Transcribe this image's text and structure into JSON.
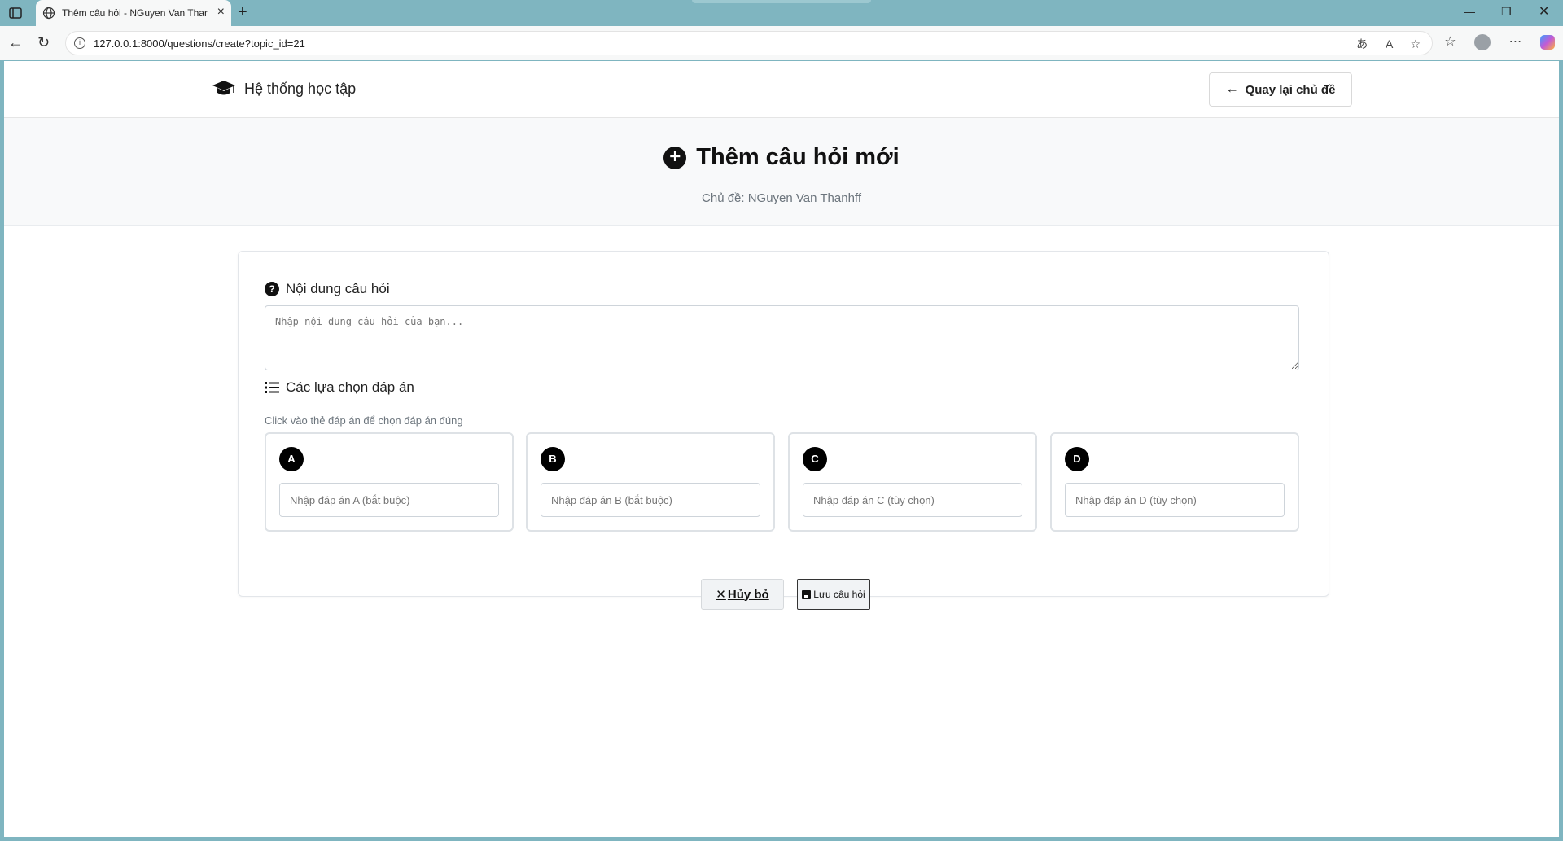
{
  "browser": {
    "tab_title": "Thêm câu hỏi - NGuyen Van Thanhff",
    "url": "127.0.0.1:8000/questions/create?topic_id=21"
  },
  "header": {
    "brand": "Hệ thống học tập",
    "back_label": "Quay lại chủ đề"
  },
  "hero": {
    "title": "Thêm câu hỏi mới",
    "subtitle": "Chủ đề: NGuyen Van Thanhff"
  },
  "form": {
    "question_label": "Nội dung câu hỏi",
    "question_placeholder": "Nhập nội dung câu hỏi của bạn...",
    "options_label": "Các lựa chọn đáp án",
    "options_hint": "Click vào thẻ đáp án để chọn đáp án đúng",
    "options": [
      {
        "letter": "A",
        "placeholder": "Nhập đáp án A (bắt buộc)"
      },
      {
        "letter": "B",
        "placeholder": "Nhập đáp án B (bắt buộc)"
      },
      {
        "letter": "C",
        "placeholder": "Nhập đáp án C (tùy chọn)"
      },
      {
        "letter": "D",
        "placeholder": "Nhập đáp án D (tùy chọn)"
      }
    ],
    "cancel_label": "Hủy bỏ",
    "save_label": "Lưu câu hỏi"
  }
}
